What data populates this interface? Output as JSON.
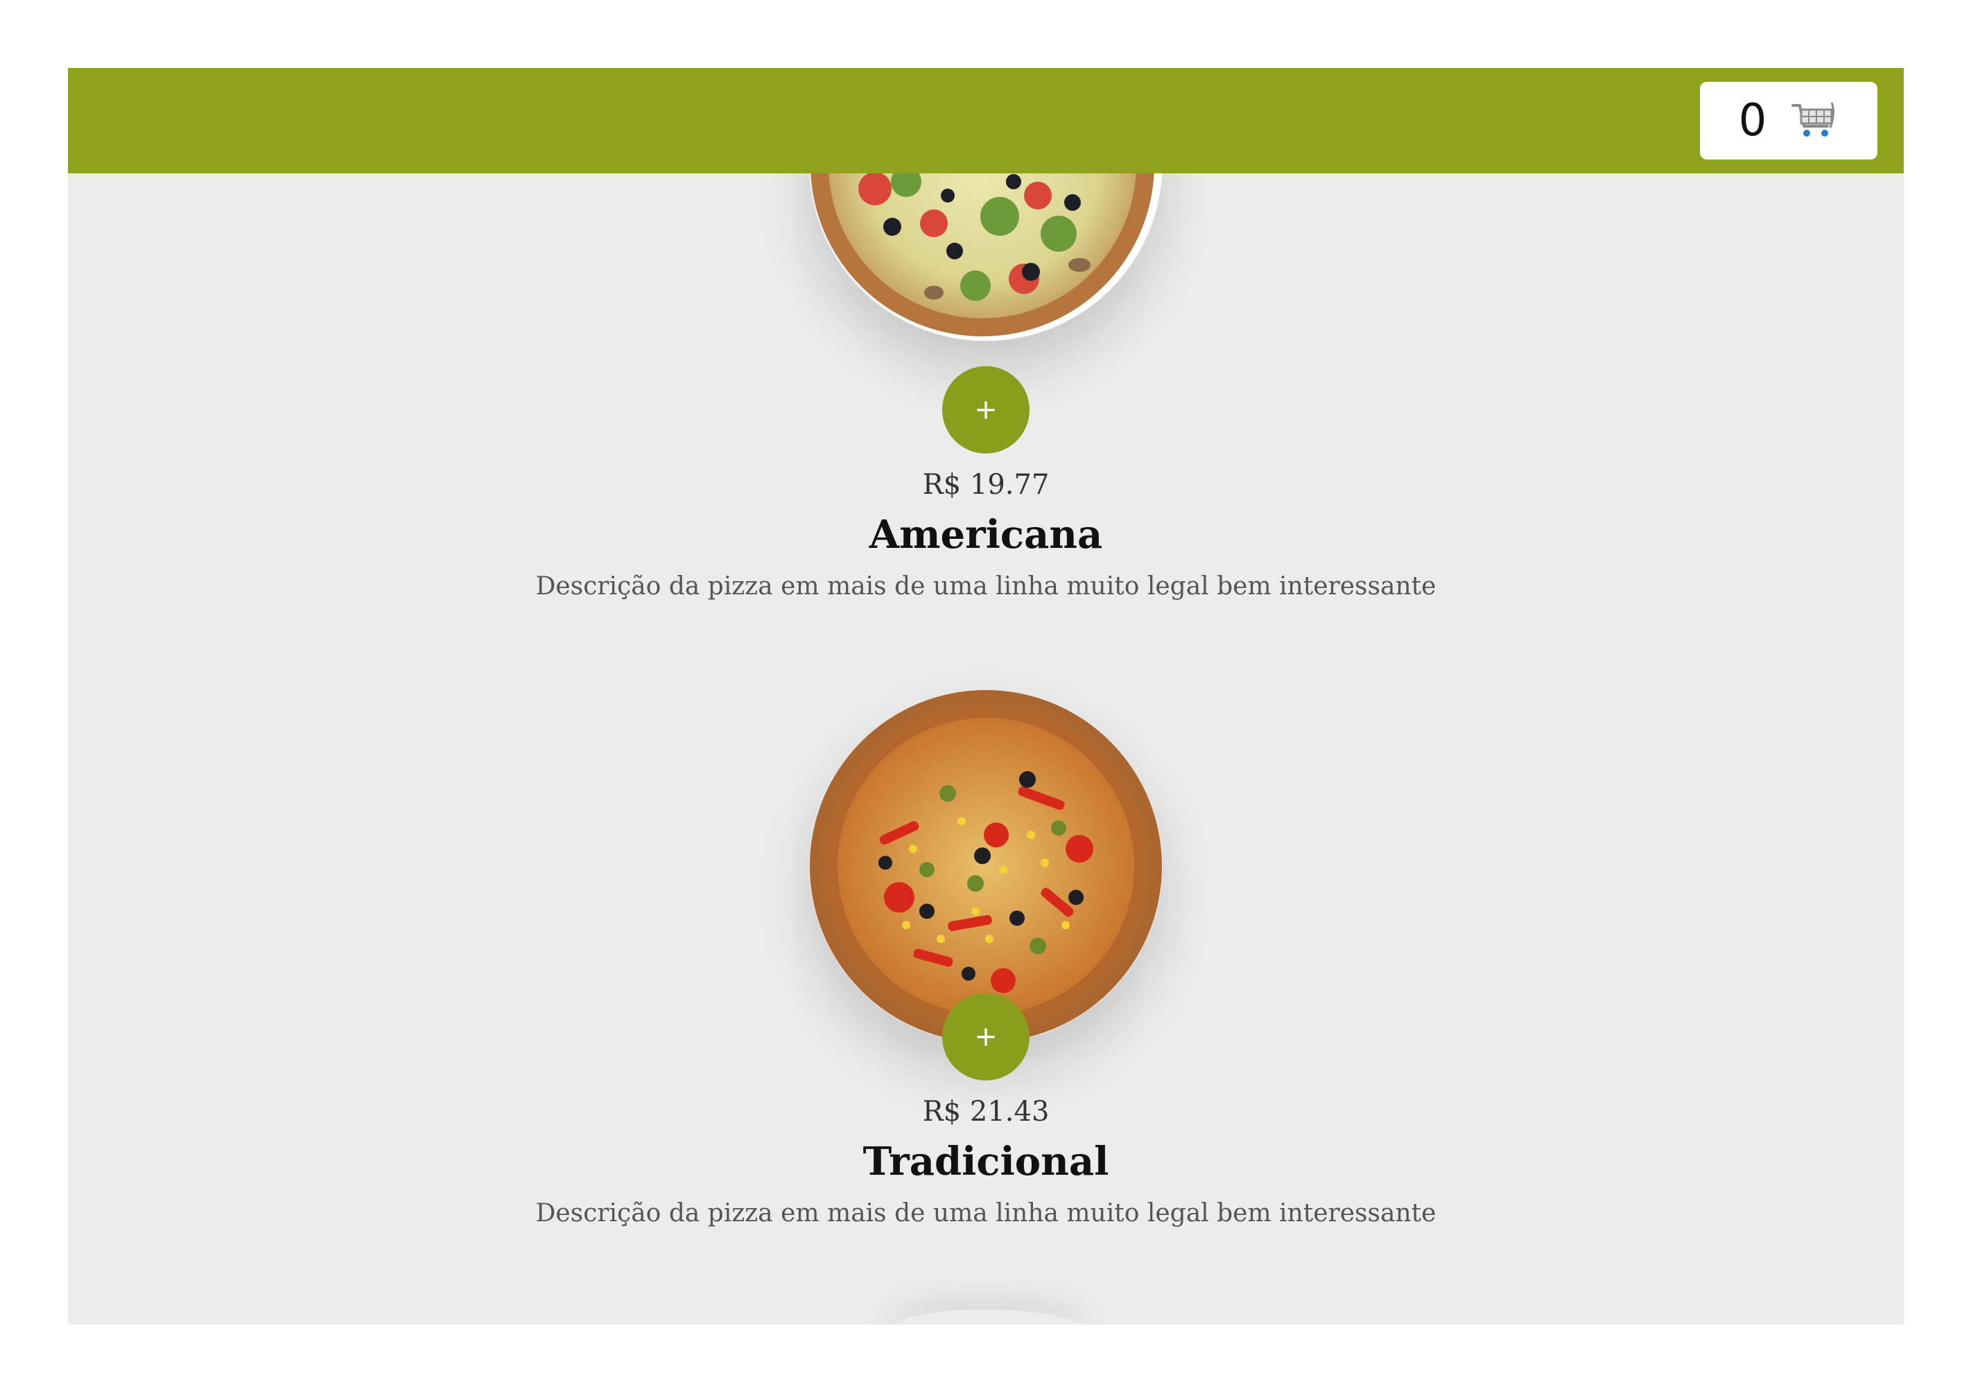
{
  "cart": {
    "count": "0",
    "icon": "shopping-cart-icon"
  },
  "products": [
    {
      "price": "R$ 19.77",
      "name": "Americana",
      "description": "Descrição da pizza em mais de uma linha muito legal bem interessante",
      "add_label": "+",
      "image": "pizza-vegetable-olive-broccoli"
    },
    {
      "price": "R$ 21.43",
      "name": "Tradicional",
      "description": "Descrição da pizza em mais de uma linha muito legal bem interessante",
      "add_label": "+",
      "image": "pizza-peppers-corn-olive"
    }
  ],
  "colors": {
    "brand": "#91a21d",
    "button": "#8a9e1d",
    "background": "#ececec"
  }
}
